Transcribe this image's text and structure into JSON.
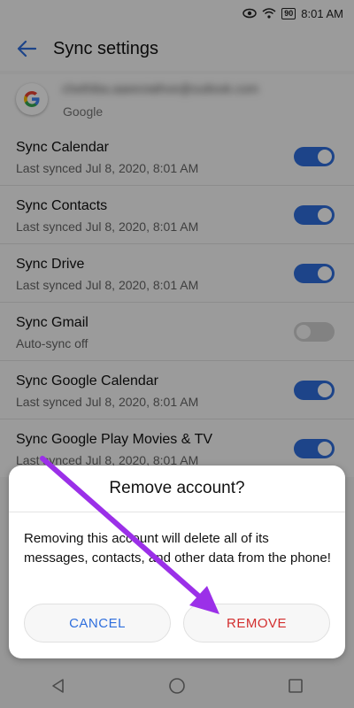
{
  "status_bar": {
    "battery": "90",
    "time": "8:01 AM",
    "icons": [
      "eye-comfort-icon",
      "wifi-icon",
      "battery-icon"
    ]
  },
  "app_bar": {
    "title": "Sync settings",
    "back_icon": "arrow-left-icon"
  },
  "account": {
    "email": "chethiba.aaeeviathve@outlook.com",
    "type": "Google",
    "logo_letter": "G"
  },
  "sync_items": [
    {
      "title": "Sync Calendar",
      "subtitle": "Last synced Jul 8, 2020, 8:01 AM",
      "enabled": true
    },
    {
      "title": "Sync Contacts",
      "subtitle": "Last synced Jul 8, 2020, 8:01 AM",
      "enabled": true
    },
    {
      "title": "Sync Drive",
      "subtitle": "Last synced Jul 8, 2020, 8:01 AM",
      "enabled": true
    },
    {
      "title": "Sync Gmail",
      "subtitle": "Auto-sync off",
      "enabled": false
    },
    {
      "title": "Sync Google Calendar",
      "subtitle": "Last synced Jul 8, 2020, 8:01 AM",
      "enabled": true
    },
    {
      "title": "Sync Google Play Movies & TV",
      "subtitle": "Last synced Jul 8, 2020, 8:01 AM",
      "enabled": true
    }
  ],
  "dialog": {
    "title": "Remove account?",
    "message": "Removing this account will delete all of its messages, contacts, and other data from the phone!",
    "cancel_label": "CANCEL",
    "remove_label": "REMOVE"
  },
  "colors": {
    "accent": "#2f6fdd",
    "danger": "#d32f2f",
    "annotation_arrow": "#9b30e8"
  }
}
